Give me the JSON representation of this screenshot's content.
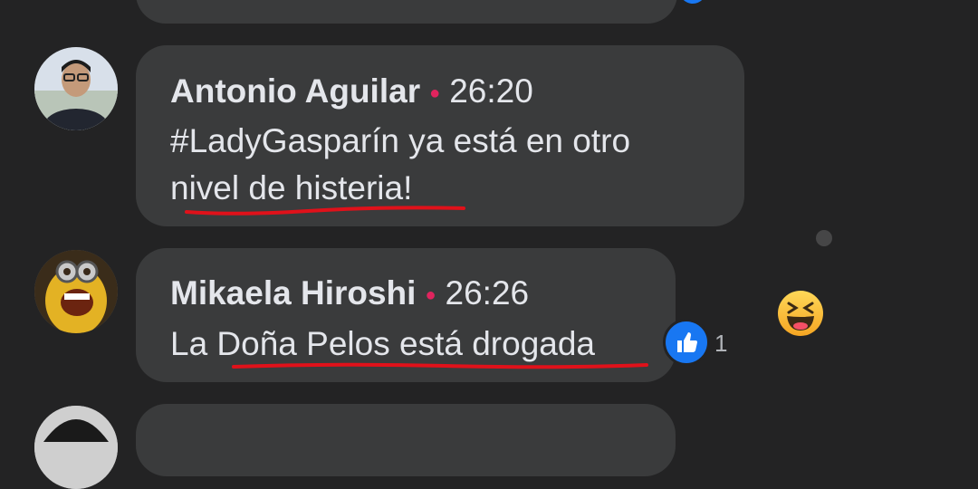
{
  "comments": [
    {
      "author": "Antonio Aguilar",
      "time": "26:20",
      "line1": "#LadyGasparín ya está en otro",
      "line2": "nivel de histeria!"
    },
    {
      "author": "Mikaela Hiroshi",
      "time": "26:26",
      "text": "La Doña Pelos está drogada",
      "like_count": "1"
    }
  ],
  "colors": {
    "background": "#232324",
    "bubble": "#3a3b3c",
    "text": "#e4e6eb",
    "like_blue": "#1877f2",
    "underline_red": "#e0111a"
  },
  "icons": [
    "like-icon",
    "haha-icon"
  ]
}
